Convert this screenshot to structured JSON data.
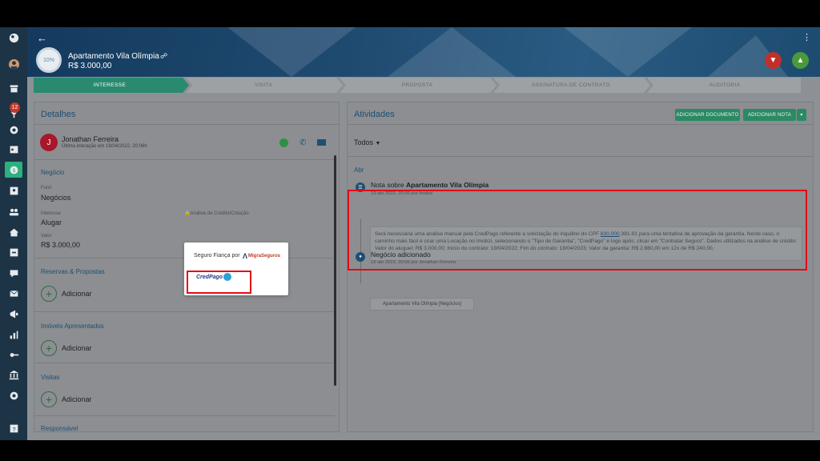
{
  "header": {
    "progress": "10%",
    "deal_title": "Apartamento Vila Olímpia",
    "deal_price": "R$ 3.000,00"
  },
  "sidebar": {
    "badge_count": "12"
  },
  "pipeline": {
    "stages": [
      "INTERESSE",
      "VISITA",
      "PROPOSTA",
      "ASSINATURA DE CONTRATO",
      "AUDITORIA"
    ],
    "active_index": 0
  },
  "details": {
    "title": "Detalhes",
    "contact": {
      "initial": "J",
      "name": "Jonathan Ferreira",
      "last_interaction": "Última interação em 19/04/2022, 20:06h"
    },
    "negocio_heading": "Negócio",
    "funil_label": "Funil",
    "funil_value": "Negócios",
    "interesse_label": "Interesse",
    "interesse_value": "Alugar",
    "valor_label": "Valor",
    "valor_value": "R$ 3.000,00",
    "credit_label": "Análise de Crédito/Cotação",
    "sections": [
      {
        "title": "Reservas & Propostas",
        "add_label": "Adicionar"
      },
      {
        "title": "Imóveis Apresentados",
        "add_label": "Adicionar"
      },
      {
        "title": "Visitas",
        "add_label": "Adicionar"
      },
      {
        "title": "Responsável",
        "add_label": ""
      }
    ]
  },
  "popup": {
    "seguro_label": "Seguro Fiança por",
    "partner_logo_text": "MigraSeguros",
    "credpago_logo_text": "CredPago"
  },
  "activities": {
    "title": "Atividades",
    "btn_add_document": "ADICIONAR DOCUMENTO",
    "btn_add_note": "ADICIONAR NOTA",
    "filter": "Todos",
    "month": "Abr",
    "note": {
      "title_prefix": "Nota sobre ",
      "title_bold": "Apartamento Vila Olímpia",
      "meta": "19 abr 2022, 20:06 por Imobzi",
      "body_1": "Será necessária uma análise manual pela CredPago referente a solicitação do inquilino do CPF ",
      "body_link": "830.000",
      "body_2": ".381-91 para uma tentativa de aprovação da garantia. Neste caso, o caminho mais fácil é criar uma Locação no Imobzi, selecionando o \"Tipo de Garantia\", \"CredPago\" e logo após, clicar em \"Contratar Seguro\". Dados utilizados na análise de crédito: Valor do aluguel: R$ 3.000,00; Início do contrato: 19/04/2022; Fim do contrato: 18/04/2023; Valor da garantia: R$ 2.880,00 em 12x de R$ 240,00,"
    },
    "negocio": {
      "title": "Negócio adicionado",
      "meta": "19 abr 2022, 20:06 por Jonathan Ferreira",
      "chip": "Apartamento Vila Olímpia [Negócios]"
    }
  },
  "colors": {
    "highlight_red": "#e10b17",
    "brand_green": "#2a8a64",
    "sidebar_bg": "#1d3346"
  }
}
